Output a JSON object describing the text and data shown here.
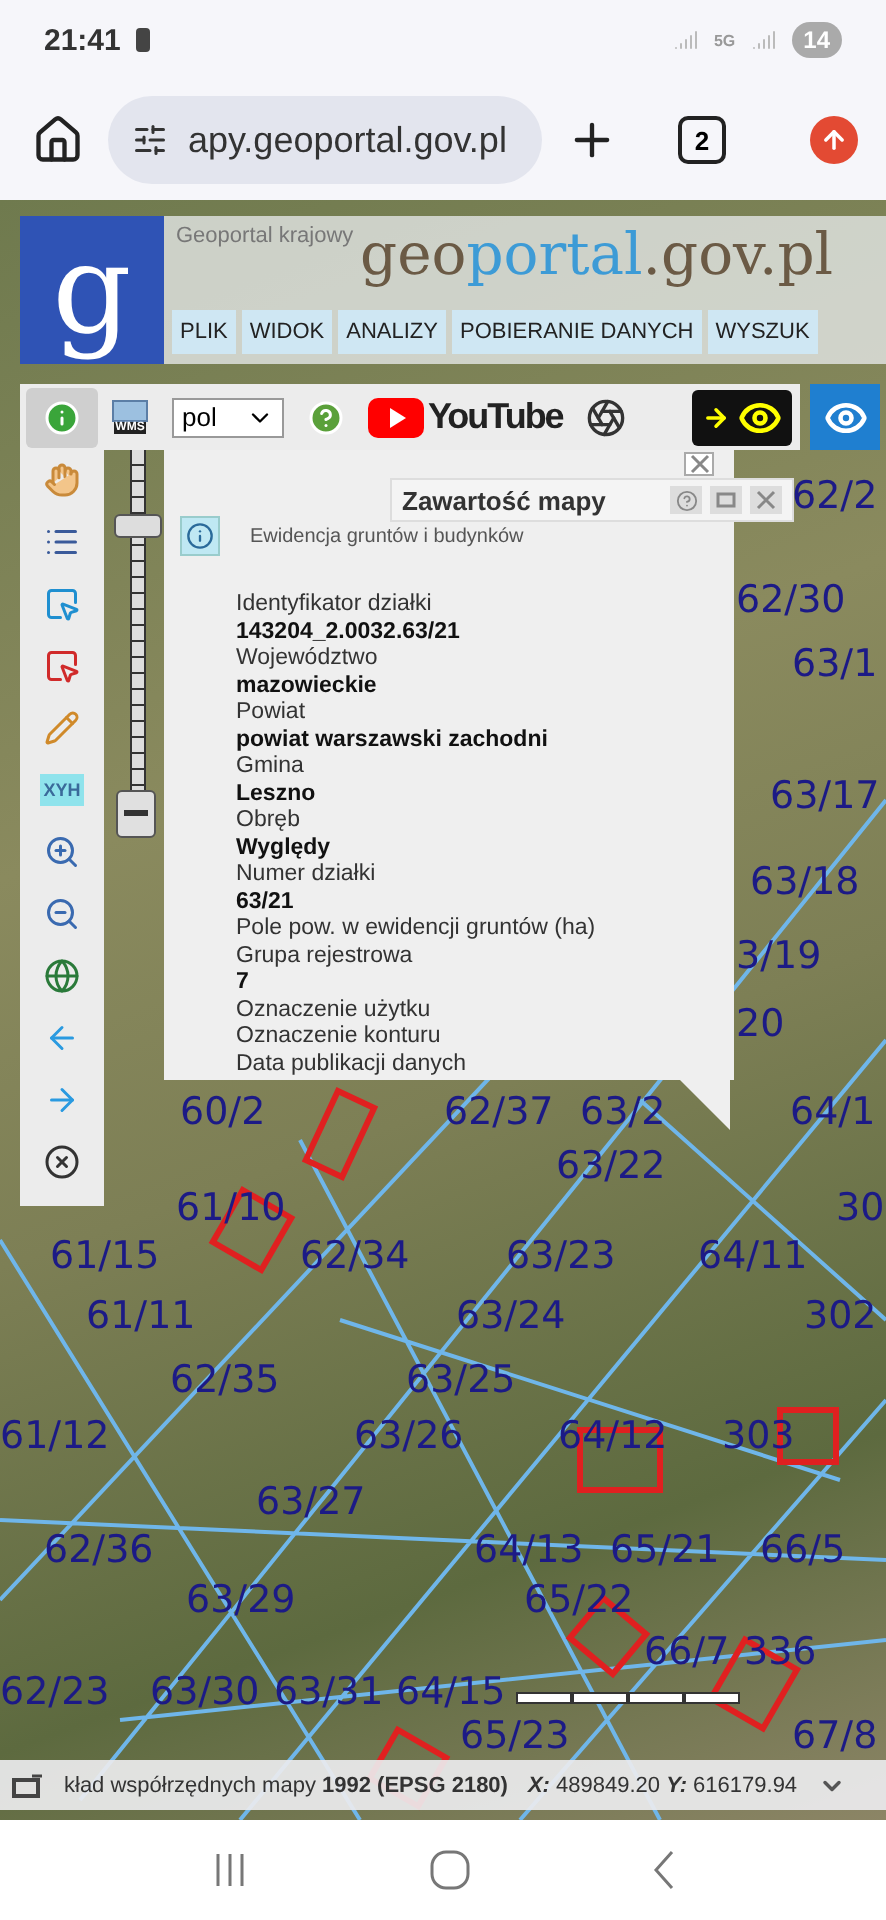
{
  "status_bar": {
    "time": "21:41",
    "network": "5G",
    "notification_count": "14"
  },
  "browser": {
    "url": "apy.geoportal.gov.pl",
    "tab_count": "2"
  },
  "header": {
    "logo_letter": "g",
    "site_label": "Geoportal krajowy",
    "brand": [
      {
        "text": "geo",
        "color": "#6b5a45"
      },
      {
        "text": "portal",
        "color": "#3d9bd6"
      },
      {
        "text": ".gov.pl",
        "color": "#6b5a45"
      }
    ],
    "menu": [
      "PLIK",
      "WIDOK",
      "ANALIZY",
      "POBIERANIE DANYCH",
      "WYSZUK"
    ]
  },
  "toolbar": {
    "wms_label": "WMS",
    "language": "pol",
    "youtube_label": "YouTube",
    "view_toggle_on": true
  },
  "tools": [
    {
      "kind": "info",
      "selected": true
    },
    {
      "kind": "pan",
      "selected": false
    },
    {
      "kind": "legend",
      "selected": false
    },
    {
      "kind": "select",
      "selected": false
    },
    {
      "kind": "deselect",
      "selected": false
    },
    {
      "kind": "draw",
      "selected": false
    },
    {
      "kind": "xyh",
      "label": "XYH",
      "selected": false
    },
    {
      "kind": "zoom-in",
      "selected": false
    },
    {
      "kind": "zoom-out",
      "selected": false
    },
    {
      "kind": "full-extent",
      "selected": false
    },
    {
      "kind": "back",
      "selected": false
    },
    {
      "kind": "forward",
      "selected": false
    },
    {
      "kind": "clear",
      "selected": false
    }
  ],
  "zoom": {
    "level": 0.8
  },
  "popup": {
    "title": "Zawartość mapy",
    "layer": "Ewidencja gruntów i budynków",
    "fields": [
      {
        "label": "Identyfikator działki",
        "value": "143204_2.0032.63/21"
      },
      {
        "label": "Województwo",
        "value": "mazowieckie"
      },
      {
        "label": "Powiat",
        "value": "powiat warszawski zachodni"
      },
      {
        "label": "Gmina",
        "value": "Leszno"
      },
      {
        "label": "Obręb",
        "value": "Wyględy"
      },
      {
        "label": "Numer działki",
        "value": "63/21"
      },
      {
        "label": "Pole pow. w ewidencji gruntów (ha)"
      },
      {
        "label": "Grupa rejestrowa",
        "value": "7"
      },
      {
        "label": "Oznaczenie użytku"
      },
      {
        "label": "Oznaczenie konturu"
      },
      {
        "label": "Data publikacji danych"
      }
    ]
  },
  "parcels": [
    "62/2",
    "62/30",
    "63/1",
    "63/17",
    "63/18",
    "3/19",
    "20",
    "60/2",
    "62/37",
    "63/2",
    "64/1",
    "63/22",
    "61/10",
    "30",
    "61/15",
    "62/34",
    "63/23",
    "64/11",
    "61/11",
    "63/24",
    "302",
    "62/35",
    "63/25",
    "61/12",
    "63/26",
    "64/12",
    "303",
    "63/27",
    "62/36",
    "64/13",
    "65/21",
    "66/5",
    "63/29",
    "65/22",
    "66/7",
    "336",
    "62/23",
    "63/30",
    "63/31",
    "64/15",
    "65/23",
    "67/8"
  ],
  "coordinates_bar": {
    "system": "kład współrzędnych mapy **1992 (EPSG 2180)**",
    "position": "**X:** 489849.20 **Y:** 616179.94"
  }
}
